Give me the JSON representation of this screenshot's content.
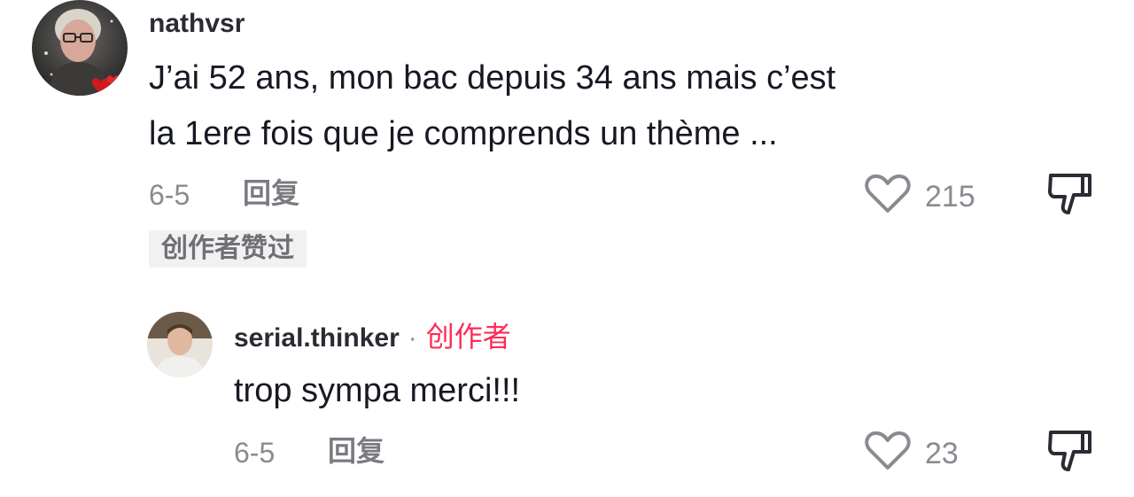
{
  "comment_main": {
    "username": "nathvsr",
    "text_line1": "J’ai 52 ans, mon bac depuis 34 ans mais c’est",
    "text_line2": "la 1ere fois que je comprends un thème ...",
    "date": "6-5",
    "reply_label": "回复",
    "like_count": "215",
    "creator_liked_badge": "创作者赞过"
  },
  "comment_reply": {
    "username": "serial.thinker",
    "separator": "·",
    "creator_label": "创作者",
    "text": "trop sympa merci!!!",
    "date": "6-5",
    "reply_label": "回复",
    "like_count": "23"
  },
  "icons": {
    "like": "heart-outline-icon",
    "dislike": "thumbs-down-outline-icon"
  },
  "colors": {
    "creator_accent": "#fe2c55",
    "muted_text": "#8a8b91",
    "badge_bg": "#f1f1f2"
  }
}
